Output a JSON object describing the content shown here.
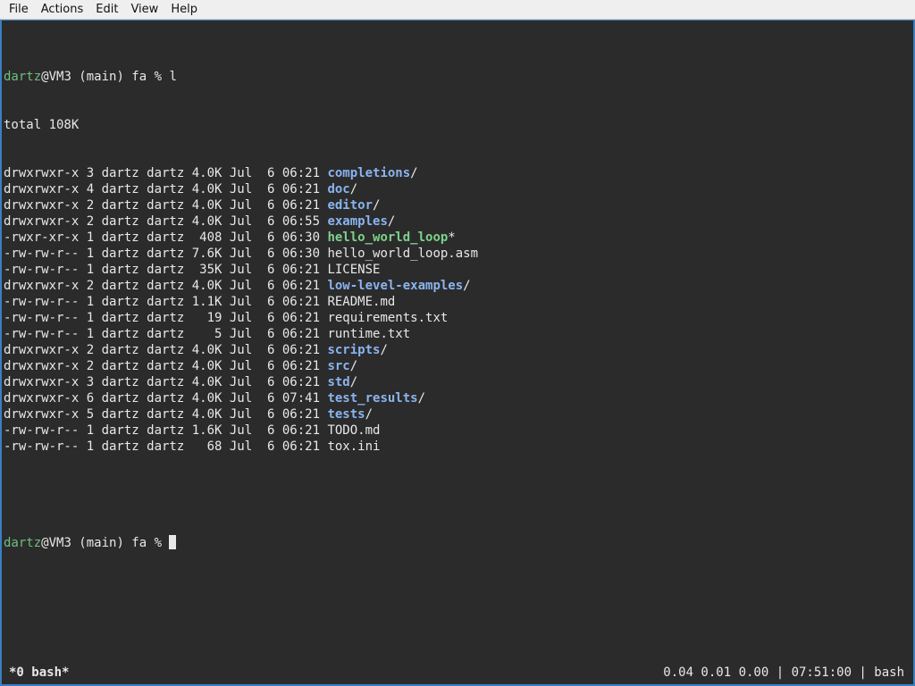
{
  "menubar": {
    "items": [
      "File",
      "Actions",
      "Edit",
      "View",
      "Help"
    ]
  },
  "prompt": {
    "user": "dartz",
    "rest": "@VM3 (main) fa % "
  },
  "command": "l",
  "total": "total 108K",
  "listing": [
    {
      "meta": "drwxrwxr-x 3 dartz dartz 4.0K Jul  6 06:21 ",
      "name": "completions",
      "kind": "dir",
      "suffix": "/"
    },
    {
      "meta": "drwxrwxr-x 4 dartz dartz 4.0K Jul  6 06:21 ",
      "name": "doc",
      "kind": "dir",
      "suffix": "/"
    },
    {
      "meta": "drwxrwxr-x 2 dartz dartz 4.0K Jul  6 06:21 ",
      "name": "editor",
      "kind": "dir",
      "suffix": "/"
    },
    {
      "meta": "drwxrwxr-x 2 dartz dartz 4.0K Jul  6 06:55 ",
      "name": "examples",
      "kind": "dir",
      "suffix": "/"
    },
    {
      "meta": "-rwxr-xr-x 1 dartz dartz  408 Jul  6 06:30 ",
      "name": "hello_world_loop",
      "kind": "exec",
      "suffix": "*"
    },
    {
      "meta": "-rw-rw-r-- 1 dartz dartz 7.6K Jul  6 06:30 ",
      "name": "hello_world_loop.asm",
      "kind": "file",
      "suffix": ""
    },
    {
      "meta": "-rw-rw-r-- 1 dartz dartz  35K Jul  6 06:21 ",
      "name": "LICENSE",
      "kind": "file",
      "suffix": ""
    },
    {
      "meta": "drwxrwxr-x 2 dartz dartz 4.0K Jul  6 06:21 ",
      "name": "low-level-examples",
      "kind": "dir",
      "suffix": "/"
    },
    {
      "meta": "-rw-rw-r-- 1 dartz dartz 1.1K Jul  6 06:21 ",
      "name": "README.md",
      "kind": "file",
      "suffix": ""
    },
    {
      "meta": "-rw-rw-r-- 1 dartz dartz   19 Jul  6 06:21 ",
      "name": "requirements.txt",
      "kind": "file",
      "suffix": ""
    },
    {
      "meta": "-rw-rw-r-- 1 dartz dartz    5 Jul  6 06:21 ",
      "name": "runtime.txt",
      "kind": "file",
      "suffix": ""
    },
    {
      "meta": "drwxrwxr-x 2 dartz dartz 4.0K Jul  6 06:21 ",
      "name": "scripts",
      "kind": "dir",
      "suffix": "/"
    },
    {
      "meta": "drwxrwxr-x 2 dartz dartz 4.0K Jul  6 06:21 ",
      "name": "src",
      "kind": "dir",
      "suffix": "/"
    },
    {
      "meta": "drwxrwxr-x 3 dartz dartz 4.0K Jul  6 06:21 ",
      "name": "std",
      "kind": "dir",
      "suffix": "/"
    },
    {
      "meta": "drwxrwxr-x 6 dartz dartz 4.0K Jul  6 07:41 ",
      "name": "test_results",
      "kind": "dir",
      "suffix": "/"
    },
    {
      "meta": "drwxrwxr-x 5 dartz dartz 4.0K Jul  6 06:21 ",
      "name": "tests",
      "kind": "dir",
      "suffix": "/"
    },
    {
      "meta": "-rw-rw-r-- 1 dartz dartz 1.6K Jul  6 06:21 ",
      "name": "TODO.md",
      "kind": "file",
      "suffix": ""
    },
    {
      "meta": "-rw-rw-r-- 1 dartz dartz   68 Jul  6 06:21 ",
      "name": "tox.ini",
      "kind": "file",
      "suffix": ""
    }
  ],
  "statusbar": {
    "left": "*0 bash*",
    "right": "0.04 0.01 0.00 | 07:51:00 | bash"
  },
  "colors": {
    "background": "#2b2b2b",
    "foreground": "#e8e8e8",
    "user": "#6fbf7f",
    "directory": "#8ab4f0",
    "executable": "#7dd38c",
    "border": "#3a7fc1"
  }
}
